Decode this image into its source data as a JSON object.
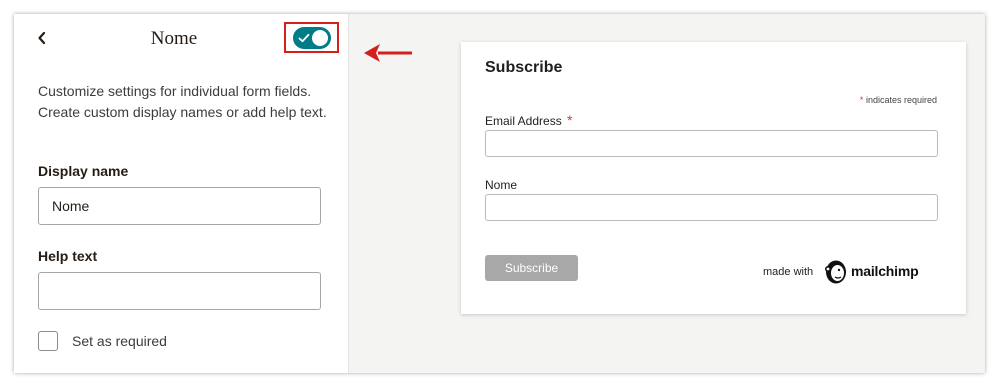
{
  "panel": {
    "title": "Nome",
    "description": "Customize settings for individual form fields. Create custom display names or add help text.",
    "display_name_label": "Display name",
    "display_name_value": "Nome",
    "help_text_label": "Help text",
    "help_text_value": "",
    "required_label": "Set as required",
    "required_checked": false,
    "toggle_on": true
  },
  "preview": {
    "title": "Subscribe",
    "required_note": "indicates required",
    "asterisk": "*",
    "email_label": "Email Address",
    "nome_label": "Nome",
    "subscribe_button": "Subscribe",
    "made_with": "made with",
    "brand": "mailchimp"
  },
  "colors": {
    "toggle": "#007c89",
    "highlight": "#d41f1f",
    "required_asterisk": "#d63a2f",
    "button_disabled": "#a8a8a8"
  },
  "icons": [
    "chevron-left-icon",
    "checkmark-icon",
    "red-arrow-annotation",
    "mailchimp-logo-icon"
  ]
}
